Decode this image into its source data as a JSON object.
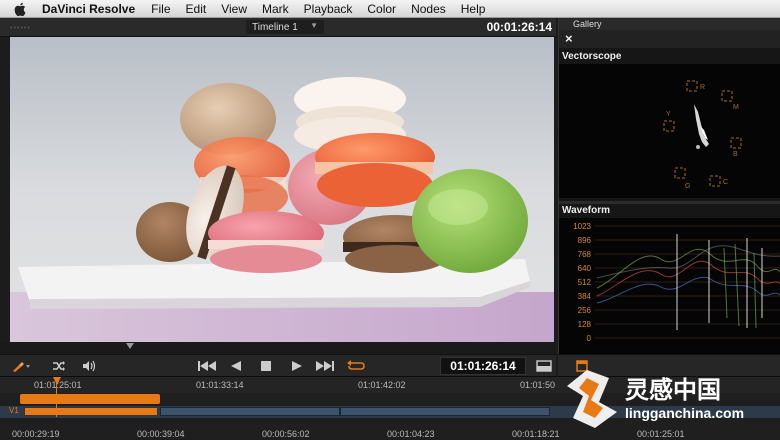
{
  "menubar": {
    "app_name": "DaVinci Resolve",
    "items": [
      "File",
      "Edit",
      "View",
      "Mark",
      "Playback",
      "Color",
      "Nodes",
      "Help"
    ]
  },
  "viewer": {
    "timeline_name": "Timeline 1",
    "timecode": "00:01:26:14"
  },
  "panels": {
    "gallery_tab": "Gallery",
    "vectorscope_title": "Vectorscope",
    "waveform_title": "Waveform",
    "vectorscope_targets": [
      "R",
      "M",
      "B",
      "C",
      "G",
      "Y"
    ],
    "waveform_scale": [
      "1023",
      "896",
      "768",
      "640",
      "512",
      "384",
      "256",
      "128",
      "0"
    ]
  },
  "transport": {
    "timecode": "01:01:26:14"
  },
  "timeline": {
    "ruler_timecodes": [
      "01:01:25:01",
      "01:01:33:14",
      "01:01:42:02",
      "01:01:50"
    ],
    "track_label": "V1",
    "bottom_timecodes": [
      "00:00:29:19",
      "00:00:39:04",
      "00:00:56:02",
      "00:01:04:23",
      "00:01:18:21",
      "00:01:25:01"
    ]
  },
  "watermark": {
    "brand_cn": "灵感中国",
    "url": "lingganchina.com"
  },
  "colors": {
    "accent_orange": "#e87a16",
    "panel_bg": "#1c1c1c"
  }
}
